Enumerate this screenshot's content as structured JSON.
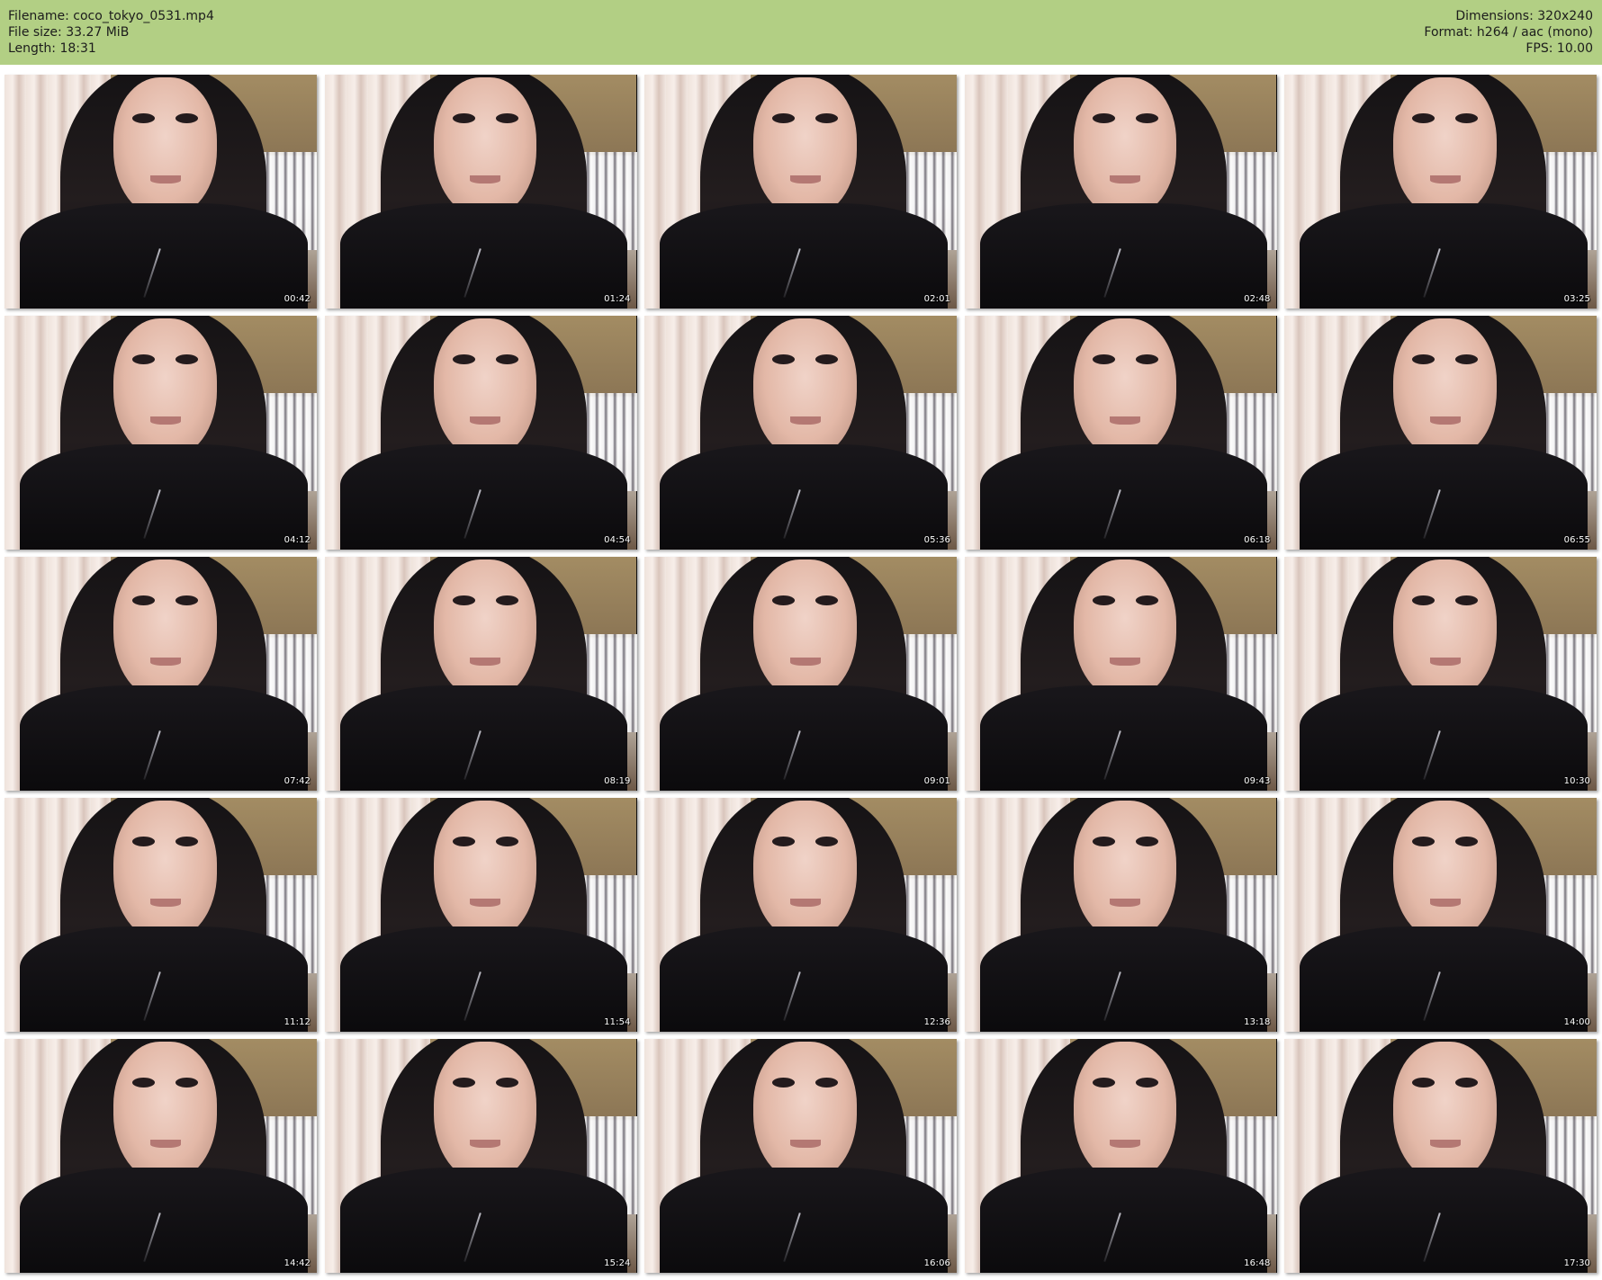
{
  "header": {
    "filename": "Filename: coco_tokyo_0531.mp4",
    "file_size": "File size: 33.27 MiB",
    "length": "Length: 18:31",
    "dimensions": "Dimensions: 320x240",
    "format": "Format: h264 / aac (mono)",
    "fps": "FPS: 10.00",
    "background_color": "#b2cf84"
  },
  "thumbnails": [
    {
      "timestamp": "00:42"
    },
    {
      "timestamp": "01:24"
    },
    {
      "timestamp": "02:01"
    },
    {
      "timestamp": "02:48"
    },
    {
      "timestamp": "03:25"
    },
    {
      "timestamp": "04:12"
    },
    {
      "timestamp": "04:54"
    },
    {
      "timestamp": "05:36"
    },
    {
      "timestamp": "06:18"
    },
    {
      "timestamp": "06:55"
    },
    {
      "timestamp": "07:42"
    },
    {
      "timestamp": "08:19"
    },
    {
      "timestamp": "09:01"
    },
    {
      "timestamp": "09:43"
    },
    {
      "timestamp": "10:30"
    },
    {
      "timestamp": "11:12"
    },
    {
      "timestamp": "11:54"
    },
    {
      "timestamp": "12:36"
    },
    {
      "timestamp": "13:18"
    },
    {
      "timestamp": "14:00"
    },
    {
      "timestamp": "14:42"
    },
    {
      "timestamp": "15:24"
    },
    {
      "timestamp": "16:06"
    },
    {
      "timestamp": "16:48"
    },
    {
      "timestamp": "17:30"
    }
  ]
}
